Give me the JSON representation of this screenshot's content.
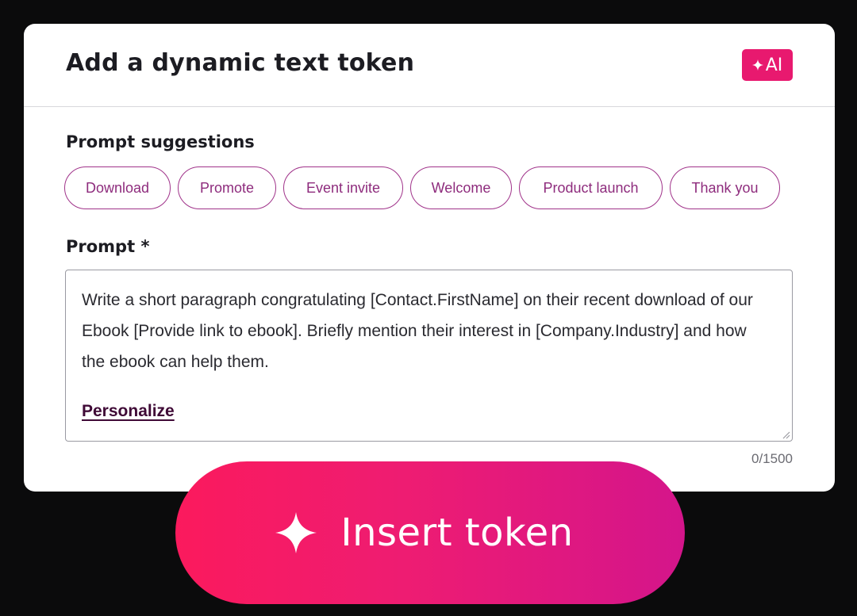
{
  "modal": {
    "title": "Add a dynamic text token",
    "ai_badge": "AI"
  },
  "suggestions": {
    "label": "Prompt suggestions",
    "chips": [
      "Download",
      "Promote",
      "Event invite",
      "Welcome",
      "Product launch",
      "Thank you"
    ]
  },
  "prompt": {
    "label": "Prompt *",
    "text": "Write a short paragraph congratulating [Contact.FirstName] on their recent download of our Ebook [Provide link to ebook]. Briefly mention their interest in [Company.Industry] and how the ebook can help them.",
    "personalize_link": "Personalize",
    "char_count": "0/1500"
  },
  "insert_button": {
    "label": "Insert token"
  },
  "colors": {
    "accent_pink": "#e8196f",
    "chip_border": "#a0338a",
    "chip_text": "#8e2c7d",
    "button_gradient_start": "#fb1a5d",
    "button_gradient_end": "#d4158b"
  },
  "icons": {
    "ai_badge_icon": "sparkle-icon",
    "insert_button_icon": "sparkle-icon"
  }
}
